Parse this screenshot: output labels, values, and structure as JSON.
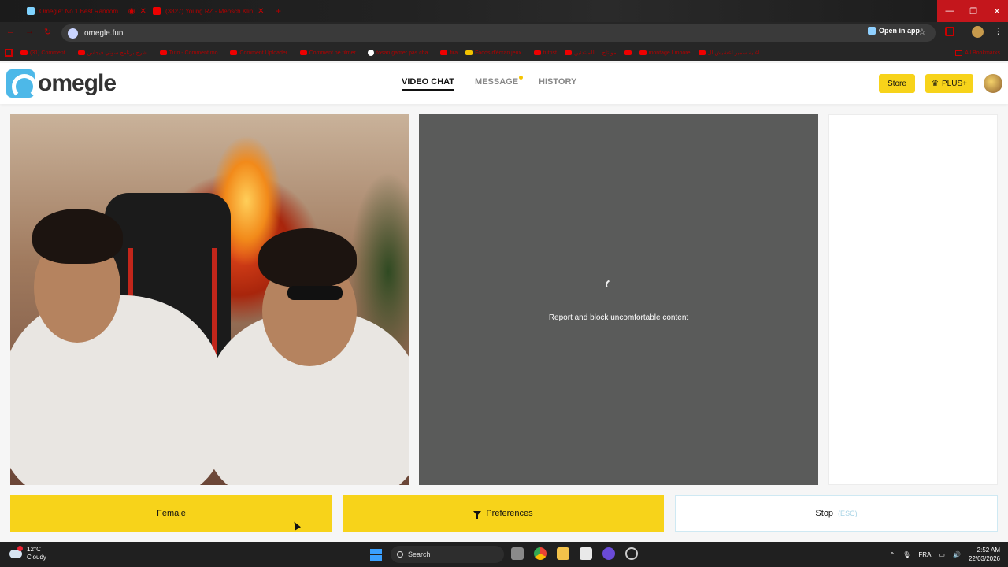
{
  "browser": {
    "tabs": [
      {
        "label": "Omegle: No.1 Best Random..."
      },
      {
        "label": "(3827) Young RZ - Mensch Klin"
      }
    ],
    "new_tab_label": "+",
    "url": "omegle.fun",
    "open_in_app": "Open in app",
    "bookmarks": [
      "(31) Comment...",
      "شرح برنامج سوني فيجاس...",
      "Tuto - Comment mo...",
      "Comment Uploader...",
      "Comment ne filmer...",
      "tosan gamer pas cha...",
      "fira",
      "Foods d'écran jeux...",
      "tutrist",
      "مونتاج ... للمبتدئين",
      "",
      "montage Lmoore",
      "اغنية سمير اعشيش ال...",
      "All Bookmarks"
    ]
  },
  "site": {
    "logo_text": "omegle",
    "nav": {
      "video_chat": "VIDEO CHAT",
      "message": "MESSAGE",
      "history": "HISTORY"
    },
    "store_label": "Store",
    "plus_label": "PLUS+",
    "report_text": "Report and block uncomfortable content",
    "buttons": {
      "female": "Female",
      "preferences": "Preferences",
      "stop": "Stop",
      "stop_shortcut": "(ESC)"
    }
  },
  "taskbar": {
    "temperature": "12°C",
    "weather": "Cloudy",
    "search_label": "Search",
    "language": "FRA",
    "time": "2:52 AM",
    "date": "22/03/2026"
  },
  "colors": {
    "accent_yellow": "#f7d31a",
    "logo_blue": "#4db8e8",
    "partner_video_bg": "#5a5b5a"
  }
}
